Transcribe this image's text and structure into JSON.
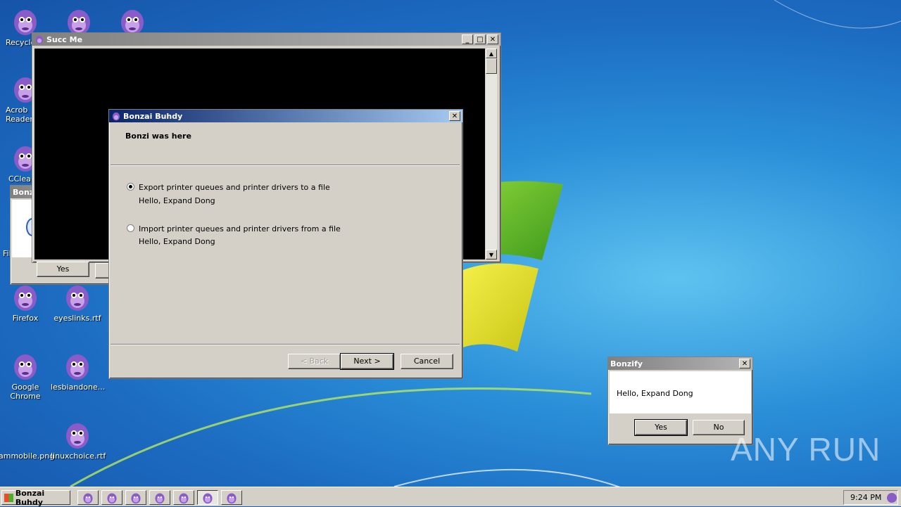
{
  "desktop": {
    "icons": [
      {
        "label": "Recycle"
      },
      {
        "label": ""
      },
      {
        "label": ""
      },
      {
        "label": "Acrob\nReader"
      },
      {
        "label": "CClea"
      },
      {
        "label": "Firefox"
      },
      {
        "label": "eyeslinks.rtf"
      },
      {
        "label": "Google\nChrome"
      },
      {
        "label": "lesbiandone..."
      },
      {
        "label": "ammobile.png"
      },
      {
        "label": "linuxchoice.rtf"
      },
      {
        "label": "Fil"
      }
    ],
    "watermark": "ANY RUN"
  },
  "succ_window": {
    "title": "Succ Me",
    "yes_label": "Yes"
  },
  "bonzai_partial_window": {
    "title": "Bonza"
  },
  "wizard": {
    "title": "Bonzai Buhdy",
    "header": "Bonzi was here",
    "options": [
      {
        "label": "Export printer queues and printer drivers to a file",
        "desc": "Hello, Expand Dong",
        "checked": true
      },
      {
        "label": "Import printer queues and printer drivers from a file",
        "desc": "Hello, Expand Dong",
        "checked": false
      }
    ],
    "back_label": "< Back",
    "next_label": "Next >",
    "cancel_label": "Cancel"
  },
  "bonzify": {
    "title": "Bonzify",
    "message": "Hello, Expand Dong",
    "yes_label": "Yes",
    "no_label": "No"
  },
  "taskbar": {
    "start_label": "Bonzai Buhdy",
    "clock": "9:24 PM"
  },
  "colors": {
    "gorilla_body": "#8a5cc8",
    "gorilla_face": "#c8a0e8",
    "titlebar_active": "#0a246a"
  }
}
